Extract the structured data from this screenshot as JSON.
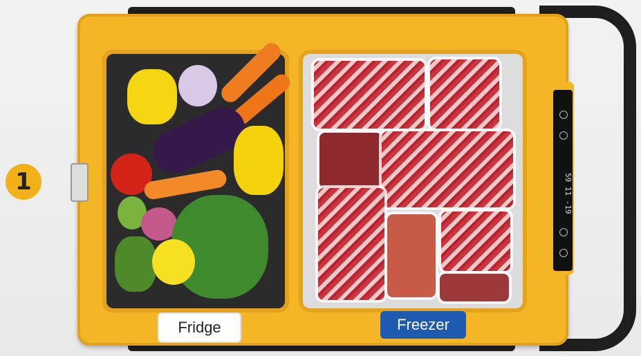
{
  "step": {
    "number": "1"
  },
  "labels": {
    "fridge": "Fridge",
    "freezer": "Freezer"
  },
  "display": {
    "readout": "59 11 -19"
  },
  "colors": {
    "shell": "#f5b626",
    "badge": "#f3b119",
    "freezer_label_bg": "#1e5bb0",
    "handle": "#1e1e1e"
  }
}
